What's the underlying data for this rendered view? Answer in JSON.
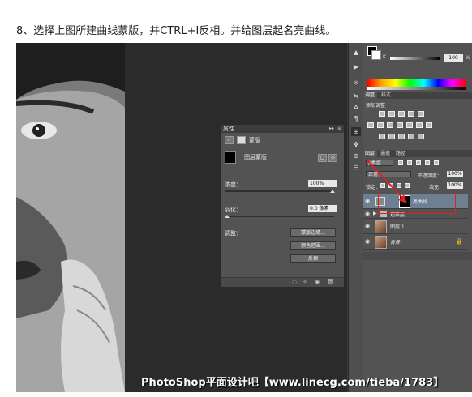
{
  "caption": "8、选择上图所建曲线蒙版，并CTRL+I反相。并给图层起名亮曲线。",
  "watermark": "PhotoShop平面设计吧【www.linecg.com/tieba/1783】",
  "properties_panel": {
    "title": "属性",
    "header_label": "蒙版",
    "mask_label": "图层蒙版",
    "density_label": "浓度：",
    "density_value": "100%",
    "feather_label": "羽化：",
    "feather_value": "0.0 像素",
    "adjust_label": "调整：",
    "buttons": [
      "蒙版边缘...",
      "颜色范围...",
      "反相"
    ],
    "collapse_glyph": "▸▸",
    "menu_glyph": "≡",
    "footer_icons": [
      "◌",
      "✧",
      "◉",
      "🗑"
    ]
  },
  "tools": {
    "items": [
      "▲",
      "▶",
      "✳",
      "⇆",
      "A",
      "¶",
      "⊞",
      "✤",
      "⊕",
      "⊟"
    ],
    "active_index": 6
  },
  "color_panel": {
    "channel_label": "K",
    "value": "100",
    "unit": "%"
  },
  "adjustments_panel": {
    "tabs": [
      "调整",
      "样式"
    ],
    "heading": "添加调整"
  },
  "layers_panel": {
    "tabs": [
      "图层",
      "通道",
      "路径"
    ],
    "kind_label": "ρ类型",
    "blend_mode": "正常",
    "opacity_label": "不透明度：",
    "opacity_value": "100%",
    "lock_label": "锁定：",
    "fill_label": "填充：",
    "fill_value": "100%",
    "layers": [
      {
        "name": "亮曲线",
        "selected": true,
        "type": "adjustment"
      },
      {
        "name": "观察层",
        "selected": false,
        "type": "group"
      },
      {
        "name": "图层 1",
        "selected": false,
        "type": "image"
      },
      {
        "name": "背景",
        "selected": false,
        "type": "background"
      }
    ]
  },
  "colors": {
    "annotation_red": "#e02020",
    "selected_layer": "#6f7f92",
    "panel_bg": "#535353"
  }
}
